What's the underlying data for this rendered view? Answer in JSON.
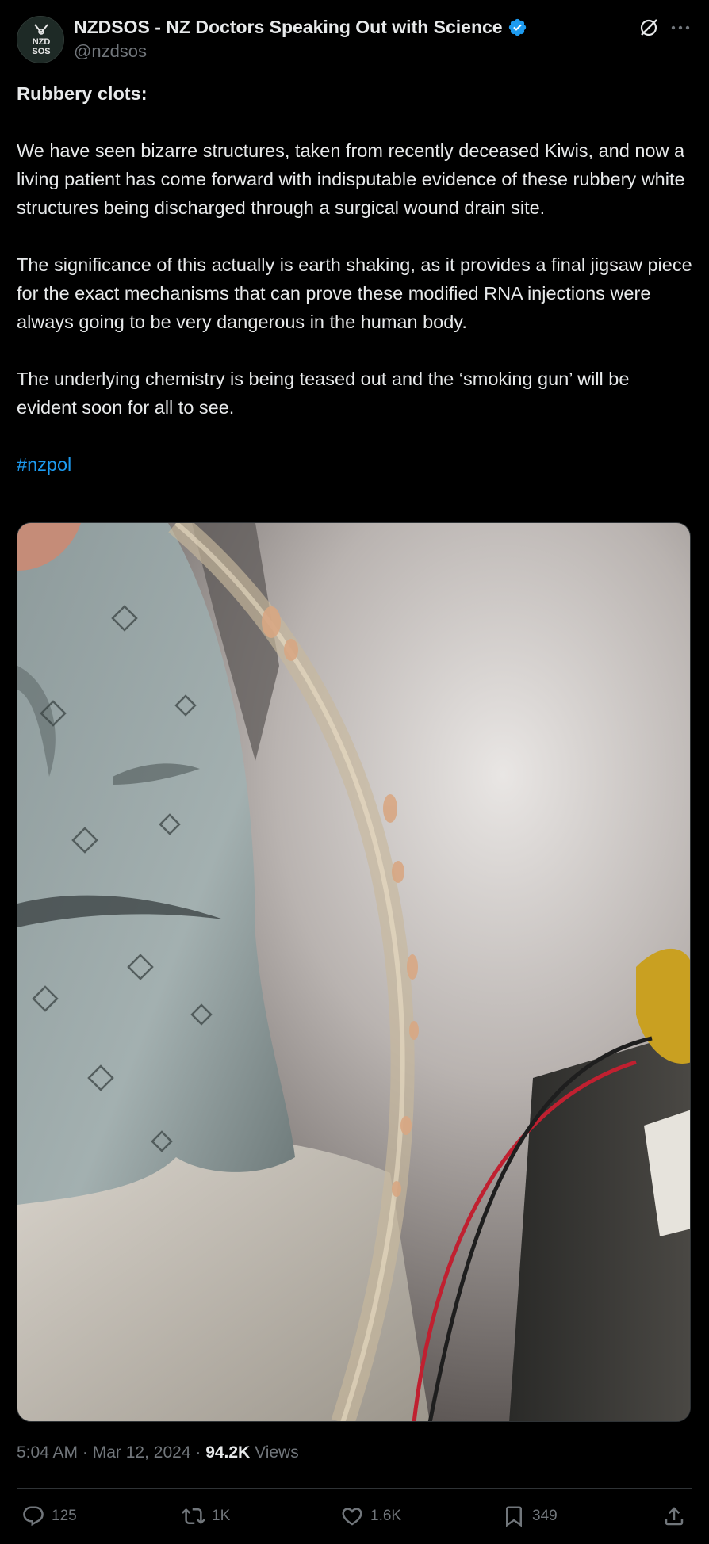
{
  "author": {
    "display_name": "NZDSOS - NZ Doctors Speaking Out with Science",
    "handle": "@nzdsos",
    "avatar_text_line1": "NZD",
    "avatar_text_line2": "SOS",
    "verified": true,
    "verified_color": "#1d9bf0"
  },
  "post": {
    "title": "Rubbery clots:",
    "paragraphs": [
      "We have seen bizarre structures, taken from recently deceased Kiwis, and now a living patient has come forward with indisputable evidence of these rubbery white structures being discharged through a surgical wound drain site.",
      "The significance of this actually is earth shaking, as it provides a final jigsaw piece for the exact mechanisms that can prove these modified RNA injections were always going to be very dangerous in the human body.",
      "The underlying chemistry is being teased out and the ‘smoking gun’ will be evident soon for all to see."
    ],
    "hashtag": "#nzpol",
    "link_color": "#1d9bf0"
  },
  "media": {
    "icon": "photo-gif"
  },
  "meta": {
    "time": "5:04 AM",
    "separator": "·",
    "date": "Mar 12, 2024",
    "views_count": "94.2K",
    "views_label": "Views"
  },
  "actions": {
    "replies": "125",
    "reposts": "1K",
    "likes": "1.6K",
    "bookmarks": "349"
  },
  "icons": [
    "grok-icon",
    "more-icon",
    "verified-icon",
    "reply-icon",
    "repost-icon",
    "like-icon",
    "bookmark-icon",
    "share-icon"
  ]
}
